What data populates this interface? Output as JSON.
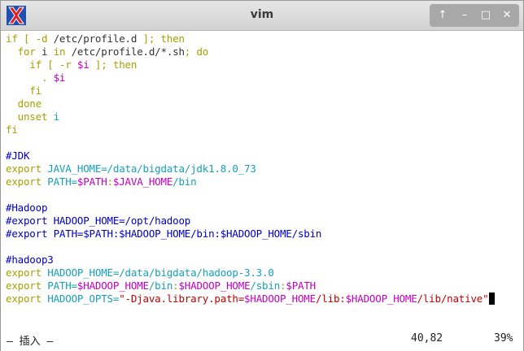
{
  "window": {
    "title": "vim",
    "controls": [
      {
        "name": "scroll-up-button",
        "glyph": "↑"
      },
      {
        "name": "minimize-button",
        "glyph": "–"
      },
      {
        "name": "maximize-button",
        "glyph": "□"
      },
      {
        "name": "close-button",
        "glyph": "✕"
      }
    ]
  },
  "editor": {
    "lines": [
      [
        [
          "kw",
          "if [ -d "
        ],
        [
          "plain",
          "/etc/profile.d"
        ],
        [
          "kw",
          " ]; then"
        ]
      ],
      [
        [
          "kw",
          "  for "
        ],
        [
          "plain",
          "i "
        ],
        [
          "kw",
          "in "
        ],
        [
          "plain",
          "/etc/profile.d/*.sh"
        ],
        [
          "kw",
          "; do"
        ]
      ],
      [
        [
          "kw",
          "    if [ -r "
        ],
        [
          "var",
          "$i"
        ],
        [
          "kw",
          " ]; then"
        ]
      ],
      [
        [
          "kw",
          "      . "
        ],
        [
          "var",
          "$i"
        ]
      ],
      [
        [
          "kw",
          "    fi"
        ]
      ],
      [
        [
          "kw",
          "  done"
        ]
      ],
      [
        [
          "kw",
          "  unset "
        ],
        [
          "ident",
          "i"
        ]
      ],
      [
        [
          "kw",
          "fi"
        ]
      ],
      [],
      [
        [
          "cmt",
          "#JDK"
        ]
      ],
      [
        [
          "stmt",
          "export "
        ],
        [
          "ident",
          "JAVA_HOME=/data/bigdata/jdk1.8.0_73"
        ]
      ],
      [
        [
          "stmt",
          "export "
        ],
        [
          "ident",
          "PATH="
        ],
        [
          "var",
          "$PATH"
        ],
        [
          "kw",
          ":"
        ],
        [
          "var",
          "$JAVA_HOME"
        ],
        [
          "ident",
          "/bin"
        ]
      ],
      [],
      [
        [
          "cmt",
          "#Hadoop"
        ]
      ],
      [
        [
          "cmt",
          "#export HADOOP_HOME=/opt/hadoop"
        ]
      ],
      [
        [
          "cmt",
          "#export PATH=$PATH:$HADOOP_HOME/bin:$HADOOP_HOME/sbin"
        ]
      ],
      [],
      [
        [
          "cmt",
          "#hadoop3"
        ]
      ],
      [
        [
          "stmt",
          "export "
        ],
        [
          "ident",
          "HADOOP_HOME=/data/bigdata/hadoop-3.3.0"
        ]
      ],
      [
        [
          "stmt",
          "export "
        ],
        [
          "ident",
          "PATH="
        ],
        [
          "var",
          "$HADOOP_HOME"
        ],
        [
          "ident",
          "/bin"
        ],
        [
          "kw",
          ":"
        ],
        [
          "var",
          "$HADOOP_HOME"
        ],
        [
          "ident",
          "/sbin"
        ],
        [
          "kw",
          ":"
        ],
        [
          "var",
          "$PATH"
        ]
      ],
      [
        [
          "stmt",
          "export "
        ],
        [
          "ident",
          "HADOOP_OPTS="
        ],
        [
          "str",
          "\"-Djava.library.path="
        ],
        [
          "var",
          "$HADOOP_HOME"
        ],
        [
          "str",
          "/lib:"
        ],
        [
          "var",
          "$HADOOP_HOME"
        ],
        [
          "str",
          "/lib/native\""
        ]
      ]
    ]
  },
  "status": {
    "mode": "— 插入 —",
    "position": "40,82",
    "percent": "39%"
  }
}
